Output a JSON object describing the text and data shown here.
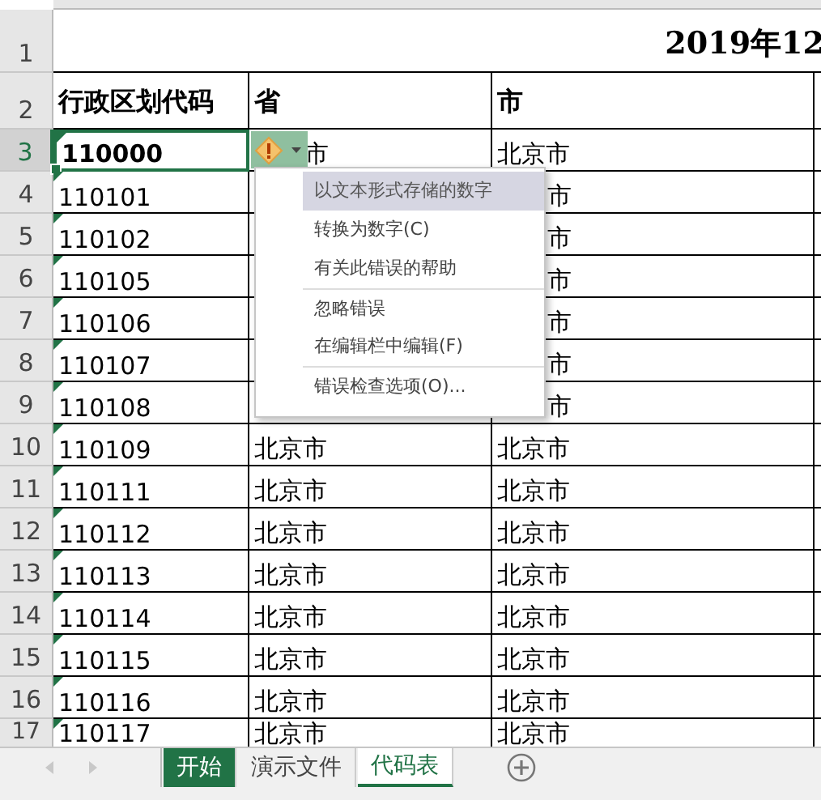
{
  "sheet": {
    "title": "2019年12",
    "header": [
      "行政区划代码",
      "省",
      "市"
    ],
    "rows": [
      {
        "number": "1",
        "kind": "title"
      },
      {
        "number": "2",
        "kind": "header"
      },
      {
        "number": "3",
        "kind": "data",
        "selected": true,
        "error_flag": true,
        "cells": [
          "110000",
          "市",
          "北京市"
        ],
        "covered": [
          false,
          true,
          false
        ]
      },
      {
        "number": "4",
        "kind": "data",
        "selected": false,
        "error_flag": true,
        "cells": [
          "110101",
          "",
          "市"
        ],
        "covered": [
          false,
          false,
          true
        ]
      },
      {
        "number": "5",
        "kind": "data",
        "selected": false,
        "error_flag": true,
        "cells": [
          "110102",
          "",
          "市"
        ],
        "covered": [
          false,
          false,
          true
        ]
      },
      {
        "number": "6",
        "kind": "data",
        "selected": false,
        "error_flag": true,
        "cells": [
          "110105",
          "",
          "市"
        ],
        "covered": [
          false,
          false,
          true
        ]
      },
      {
        "number": "7",
        "kind": "data",
        "selected": false,
        "error_flag": true,
        "cells": [
          "110106",
          "",
          "市"
        ],
        "covered": [
          false,
          false,
          true
        ]
      },
      {
        "number": "8",
        "kind": "data",
        "selected": false,
        "error_flag": true,
        "cells": [
          "110107",
          "",
          "市"
        ],
        "covered": [
          false,
          false,
          true
        ]
      },
      {
        "number": "9",
        "kind": "data",
        "selected": false,
        "error_flag": true,
        "cells": [
          "110108",
          "",
          "市"
        ],
        "covered": [
          false,
          false,
          true
        ]
      },
      {
        "number": "10",
        "kind": "data",
        "selected": false,
        "error_flag": true,
        "cells": [
          "110109",
          "北京市",
          "北京市"
        ]
      },
      {
        "number": "11",
        "kind": "data",
        "selected": false,
        "error_flag": true,
        "cells": [
          "110111",
          "北京市",
          "北京市"
        ]
      },
      {
        "number": "12",
        "kind": "data",
        "selected": false,
        "error_flag": true,
        "cells": [
          "110112",
          "北京市",
          "北京市"
        ]
      },
      {
        "number": "13",
        "kind": "data",
        "selected": false,
        "error_flag": true,
        "cells": [
          "110113",
          "北京市",
          "北京市"
        ]
      },
      {
        "number": "14",
        "kind": "data",
        "selected": false,
        "error_flag": true,
        "cells": [
          "110114",
          "北京市",
          "北京市"
        ]
      },
      {
        "number": "15",
        "kind": "data",
        "selected": false,
        "error_flag": true,
        "cells": [
          "110115",
          "北京市",
          "北京市"
        ]
      },
      {
        "number": "16",
        "kind": "data",
        "selected": false,
        "error_flag": true,
        "cells": [
          "110116",
          "北京市",
          "北京市"
        ]
      },
      {
        "number": "17",
        "kind": "data",
        "selected": false,
        "error_flag": true,
        "cells": [
          "110117",
          "北京市",
          "北京市"
        ]
      }
    ]
  },
  "error_menu": {
    "items": [
      {
        "label": "以文本形式存储的数字",
        "kind": "header",
        "separator_before": false
      },
      {
        "label": "转换为数字(C)",
        "kind": "item",
        "separator_before": false
      },
      {
        "label": "有关此错误的帮助",
        "kind": "item",
        "separator_before": false
      },
      {
        "label": "忽略错误",
        "kind": "item",
        "separator_before": true
      },
      {
        "label": "在编辑栏中编辑(F)",
        "kind": "item",
        "separator_before": false
      },
      {
        "label": "错误检查选项(O)...",
        "kind": "item",
        "separator_before": true
      }
    ]
  },
  "sheet_tabs": [
    {
      "label": "开始",
      "selected": false,
      "color": "#217346"
    },
    {
      "label": "演示文件",
      "selected": false
    },
    {
      "label": "代码表",
      "selected": true
    }
  ]
}
